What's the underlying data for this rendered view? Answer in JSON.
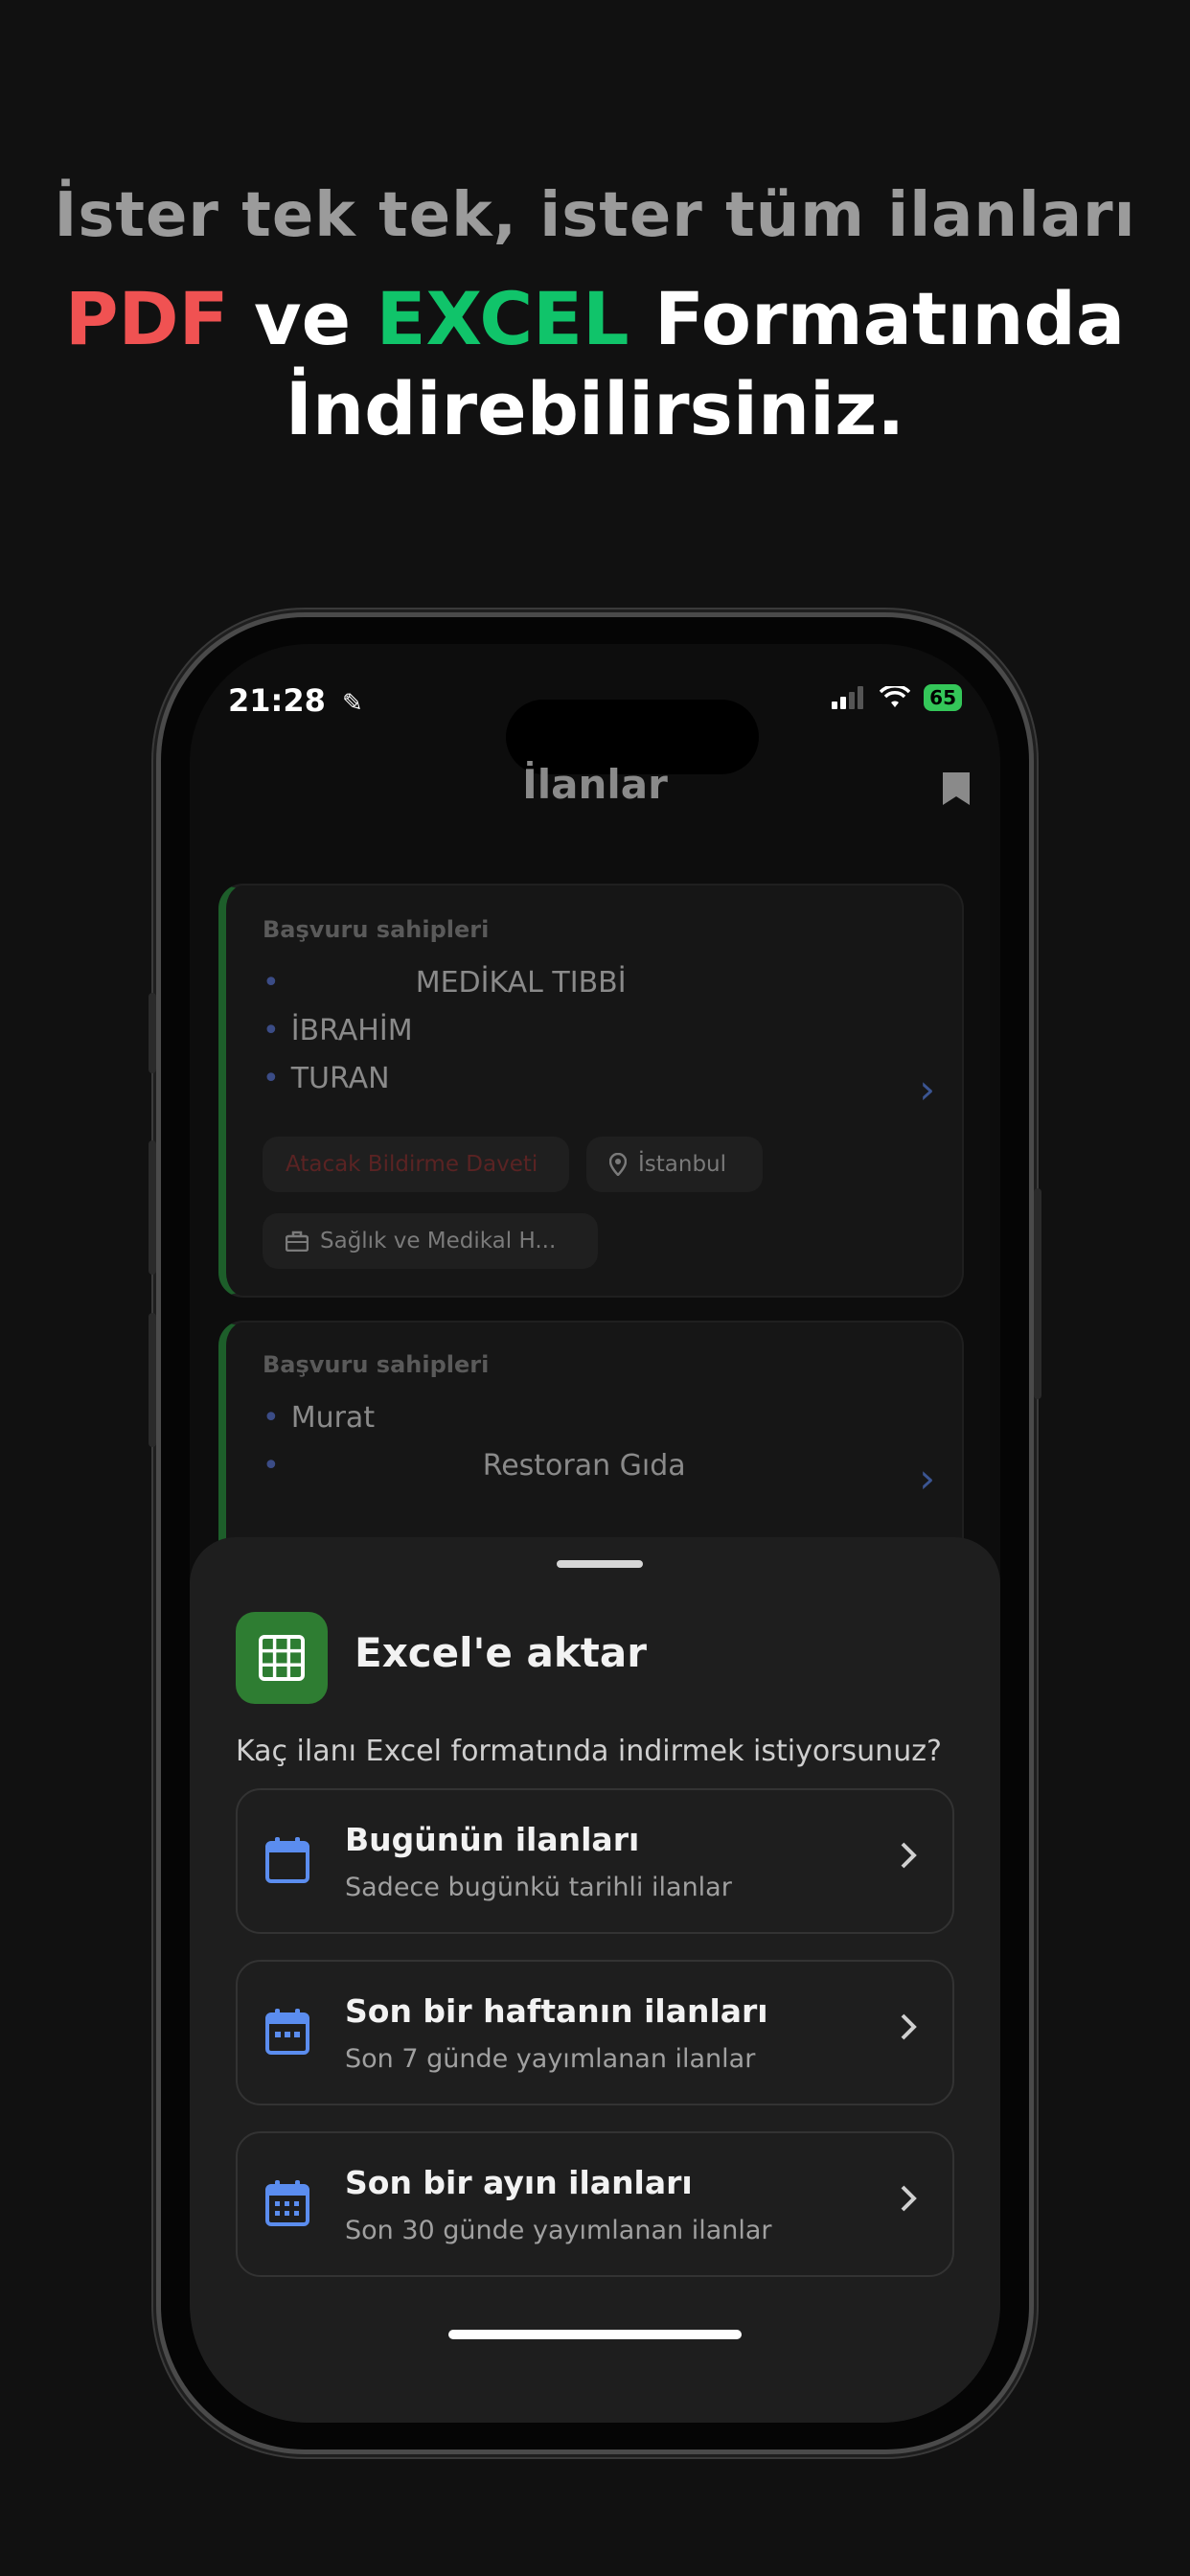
{
  "headline": {
    "line1": "İster tek tek, ister tüm ilanları",
    "pdf": "PDF",
    "ve": " ve ",
    "excel": "EXCEL",
    "formatinda": " Formatında",
    "line3": "İndirebilirsiniz."
  },
  "status_bar": {
    "time": "21:28",
    "battery": "65"
  },
  "nav": {
    "title": "İlanlar"
  },
  "cards": [
    {
      "label": "Başvuru sahipleri",
      "applicants": [
        "MEDİKAL TIBBİ",
        "İBRAHİM",
        "TURAN"
      ],
      "chip_status": "Atacak Bildirme Daveti",
      "chip_location": "İstanbul",
      "chip_sector": "Sağlık ve Medikal H..."
    },
    {
      "label": "Başvuru sahipleri",
      "applicants": [
        "Murat",
        "Restoran Gıda"
      ]
    }
  ],
  "sheet": {
    "title": "Excel'e aktar",
    "subtitle": "Kaç ilanı Excel formatında indirmek istiyorsunuz?",
    "options": [
      {
        "title": "Bugünün ilanları",
        "subtitle": "Sadece bugünkü tarihli ilanlar"
      },
      {
        "title": "Son bir haftanın ilanları",
        "subtitle": "Son 7 günde yayımlanan ilanlar"
      },
      {
        "title": "Son bir ayın ilanları",
        "subtitle": "Son 30 günde yayımlanan ilanlar"
      }
    ]
  },
  "colors": {
    "accent_red": "#f05252",
    "accent_green": "#10c46a",
    "excel_green": "#2e7d32",
    "icon_blue": "#5b8def"
  }
}
